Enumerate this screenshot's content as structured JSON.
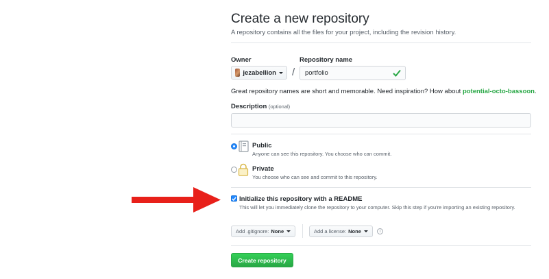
{
  "header": {
    "title": "Create a new repository",
    "subtitle": "A repository contains all the files for your project, including the revision history."
  },
  "owner": {
    "label": "Owner",
    "value": "jezabellion"
  },
  "repo_name": {
    "label": "Repository name",
    "value": "portfolio",
    "separator": "/"
  },
  "hint": {
    "text": "Great repository names are short and memorable. Need inspiration? How about ",
    "suggestion": "potential-octo-bassoon",
    "suffix": "."
  },
  "description": {
    "label": "Description",
    "optional": "(optional)",
    "value": ""
  },
  "visibility": {
    "selected": "public",
    "public": {
      "label": "Public",
      "desc": "Anyone can see this repository. You choose who can commit."
    },
    "private": {
      "label": "Private",
      "desc": "You choose who can see and commit to this repository."
    }
  },
  "readme": {
    "checked": true,
    "label": "Initialize this repository with a README",
    "desc": "This will let you immediately clone the repository to your computer. Skip this step if you're importing an existing repository."
  },
  "gitignore": {
    "prefix": "Add .gitignore:",
    "value": "None"
  },
  "license": {
    "prefix": "Add a license:",
    "value": "None"
  },
  "info_icon": "i",
  "submit": {
    "label": "Create repository"
  },
  "colors": {
    "accent": "#2188ff",
    "success": "#28a745",
    "arrow": "#e8201a"
  }
}
